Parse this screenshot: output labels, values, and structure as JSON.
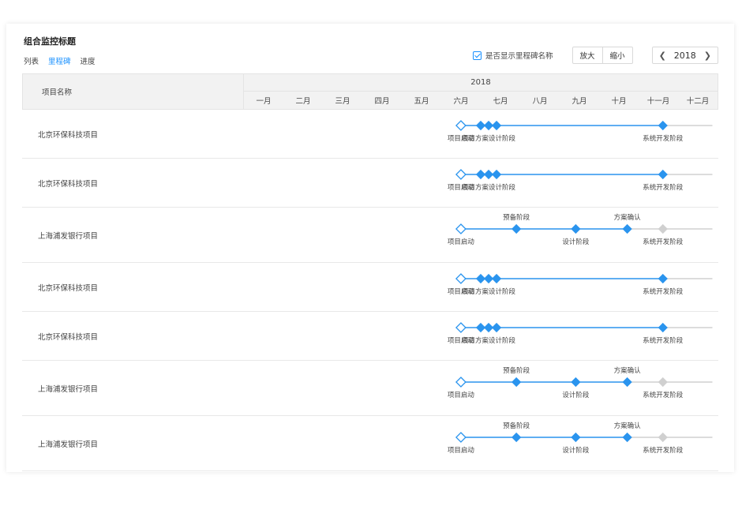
{
  "title": "组合监控标题",
  "tabs": [
    {
      "label": "列表",
      "active": false
    },
    {
      "label": "里程碑",
      "active": true
    },
    {
      "label": "进度",
      "active": false
    }
  ],
  "toolbar": {
    "show_milestone_label": "是否显示里程碑名称",
    "show_milestone_checked": true,
    "zoom_in": "放大",
    "zoom_out": "缩小",
    "year": "2018",
    "prev_icon": "chevron-left-icon",
    "next_icon": "chevron-right-icon"
  },
  "colors": {
    "accent": "#1890ff",
    "line": "#2a94ee",
    "future": "#d0d0d0"
  },
  "table": {
    "name_header": "项目名称",
    "year": "2018",
    "months": [
      "一月",
      "二月",
      "三月",
      "四月",
      "五月",
      "六月",
      "七月",
      "八月",
      "九月",
      "十月",
      "十一月",
      "十二月"
    ]
  },
  "projects": [
    {
      "name": "北京环保科技项目",
      "style": "b",
      "milestones": [
        {
          "month": 6.0,
          "name": "项目启动",
          "status": "start",
          "label": "below"
        },
        {
          "month": 6.5,
          "name": "",
          "status": "done"
        },
        {
          "month": 6.7,
          "name": "项目方案设计阶段",
          "status": "done",
          "label": "below"
        },
        {
          "month": 6.9,
          "name": "",
          "status": "done"
        },
        {
          "month": 11.1,
          "name": "系统开发阶段",
          "status": "done",
          "label": "below"
        }
      ],
      "progress_end": 11.1,
      "line_end": 12.35
    },
    {
      "name": "北京环保科技项目",
      "style": "b",
      "milestones": [
        {
          "month": 6.0,
          "name": "项目启动",
          "status": "start",
          "label": "below"
        },
        {
          "month": 6.5,
          "name": "",
          "status": "done"
        },
        {
          "month": 6.7,
          "name": "项目方案设计阶段",
          "status": "done",
          "label": "below"
        },
        {
          "month": 6.9,
          "name": "",
          "status": "done"
        },
        {
          "month": 11.1,
          "name": "系统开发阶段",
          "status": "done",
          "label": "below"
        }
      ],
      "progress_end": 11.1,
      "line_end": 12.35
    },
    {
      "name": "上海浦发银行项目",
      "style": "s",
      "milestones": [
        {
          "month": 6.0,
          "name": "项目启动",
          "status": "start",
          "label": "below"
        },
        {
          "month": 7.4,
          "name": "预备阶段",
          "status": "done",
          "label": "above"
        },
        {
          "month": 8.9,
          "name": "设计阶段",
          "status": "done",
          "label": "below"
        },
        {
          "month": 10.2,
          "name": "方案确认",
          "status": "done",
          "label": "above"
        },
        {
          "month": 11.1,
          "name": "系统开发阶段",
          "status": "pending",
          "label": "below"
        }
      ],
      "progress_end": 10.2,
      "line_end": 12.35
    },
    {
      "name": "北京环保科技项目",
      "style": "b",
      "milestones": [
        {
          "month": 6.0,
          "name": "项目启动",
          "status": "start",
          "label": "below"
        },
        {
          "month": 6.5,
          "name": "",
          "status": "done"
        },
        {
          "month": 6.7,
          "name": "项目方案设计阶段",
          "status": "done",
          "label": "below"
        },
        {
          "month": 6.9,
          "name": "",
          "status": "done"
        },
        {
          "month": 11.1,
          "name": "系统开发阶段",
          "status": "done",
          "label": "below"
        }
      ],
      "progress_end": 11.1,
      "line_end": 12.35
    },
    {
      "name": "北京环保科技项目",
      "style": "b",
      "milestones": [
        {
          "month": 6.0,
          "name": "项目启动",
          "status": "start",
          "label": "below"
        },
        {
          "month": 6.5,
          "name": "",
          "status": "done"
        },
        {
          "month": 6.7,
          "name": "项目方案设计阶段",
          "status": "done",
          "label": "below"
        },
        {
          "month": 6.9,
          "name": "",
          "status": "done"
        },
        {
          "month": 11.1,
          "name": "系统开发阶段",
          "status": "done",
          "label": "below"
        }
      ],
      "progress_end": 11.1,
      "line_end": 12.35
    },
    {
      "name": "上海浦发银行项目",
      "style": "s",
      "milestones": [
        {
          "month": 6.0,
          "name": "项目启动",
          "status": "start",
          "label": "below"
        },
        {
          "month": 7.4,
          "name": "预备阶段",
          "status": "done",
          "label": "above"
        },
        {
          "month": 8.9,
          "name": "设计阶段",
          "status": "done",
          "label": "below"
        },
        {
          "month": 10.2,
          "name": "方案确认",
          "status": "done",
          "label": "above"
        },
        {
          "month": 11.1,
          "name": "系统开发阶段",
          "status": "pending",
          "label": "below"
        }
      ],
      "progress_end": 10.2,
      "line_end": 12.35
    },
    {
      "name": "上海浦发银行项目",
      "style": "s",
      "milestones": [
        {
          "month": 6.0,
          "name": "项目启动",
          "status": "start",
          "label": "below"
        },
        {
          "month": 7.4,
          "name": "预备阶段",
          "status": "done",
          "label": "above"
        },
        {
          "month": 8.9,
          "name": "设计阶段",
          "status": "done",
          "label": "below"
        },
        {
          "month": 10.2,
          "name": "方案确认",
          "status": "done",
          "label": "above"
        },
        {
          "month": 11.1,
          "name": "系统开发阶段",
          "status": "pending",
          "label": "below"
        }
      ],
      "progress_end": 10.2,
      "line_end": 12.35
    }
  ]
}
